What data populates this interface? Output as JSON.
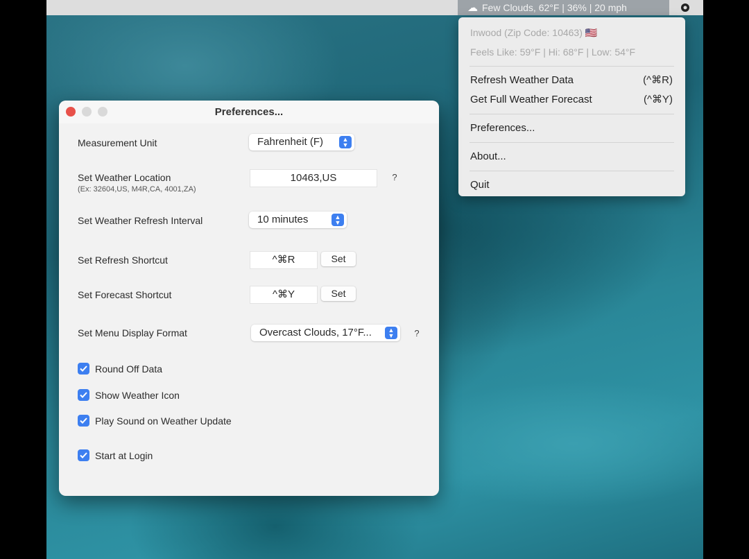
{
  "menubar": {
    "status_text": "Few Clouds, 62°F | 36% | 20 mph"
  },
  "menu": {
    "location": "Inwood (Zip Code: 10463) 🇺🇸",
    "feels_like": "Feels Like: 59°F | Hi: 68°F | Low: 54°F",
    "items": [
      {
        "label": "Refresh Weather Data",
        "shortcut": "(^⌘R)"
      },
      {
        "label": "Get Full Weather Forecast",
        "shortcut": "(^⌘Y)"
      },
      {
        "label": "Preferences..."
      },
      {
        "label": "About..."
      },
      {
        "label": "Quit"
      }
    ]
  },
  "window": {
    "title": "Preferences...",
    "measurement_unit": {
      "label": "Measurement Unit",
      "value": "Fahrenheit (F)"
    },
    "location": {
      "label": "Set Weather Location",
      "hint": "(Ex: 32604,US, M4R,CA, 4001,ZA)",
      "value": "10463,US",
      "help": "?"
    },
    "refresh_interval": {
      "label": "Set Weather Refresh Interval",
      "value": "10 minutes"
    },
    "refresh_shortcut": {
      "label": "Set Refresh Shortcut",
      "value": "^⌘R",
      "button": "Set"
    },
    "forecast_shortcut": {
      "label": "Set Forecast Shortcut",
      "value": "^⌘Y",
      "button": "Set"
    },
    "display_format": {
      "label": "Set Menu Display Format",
      "value": "Overcast Clouds, 17°F...",
      "help": "?"
    },
    "checkboxes": [
      {
        "label": "Round Off Data",
        "checked": true
      },
      {
        "label": "Show Weather Icon",
        "checked": true
      },
      {
        "label": "Play Sound on Weather Update",
        "checked": true
      },
      {
        "label": "Start at Login",
        "checked": true
      }
    ]
  }
}
